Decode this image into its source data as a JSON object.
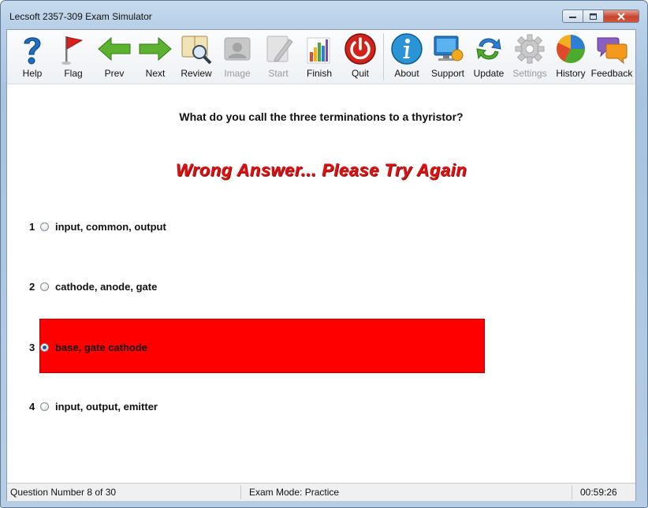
{
  "window": {
    "title": "Lecsoft 2357-309 Exam Simulator"
  },
  "toolbar": {
    "items": [
      {
        "label": "Help",
        "icon": "help-icon"
      },
      {
        "label": "Flag",
        "icon": "flag-icon"
      },
      {
        "label": "Prev",
        "icon": "prev-arrow-icon"
      },
      {
        "label": "Next",
        "icon": "next-arrow-icon"
      },
      {
        "label": "Review",
        "icon": "review-magnifier-icon"
      },
      {
        "label": "Image",
        "icon": "image-icon",
        "disabled": true
      },
      {
        "label": "Start",
        "icon": "start-pencil-icon",
        "disabled": true
      },
      {
        "label": "Finish",
        "icon": "finish-chart-icon"
      },
      {
        "label": "Quit",
        "icon": "power-icon"
      },
      {
        "label": "About",
        "icon": "info-icon"
      },
      {
        "label": "Support",
        "icon": "support-monitor-icon"
      },
      {
        "label": "Update",
        "icon": "update-arrows-icon"
      },
      {
        "label": "Settings",
        "icon": "gear-icon",
        "disabled": true
      },
      {
        "label": "History",
        "icon": "pie-chart-icon"
      },
      {
        "label": "Feedback",
        "icon": "speech-bubbles-icon"
      }
    ]
  },
  "question": {
    "text": "What do you call the three terminations to a thyristor?"
  },
  "feedback": {
    "text": "Wrong Answer... Please Try Again",
    "color": "#e01010"
  },
  "answers": [
    {
      "number": "1",
      "text": "input, common, output",
      "selected": false
    },
    {
      "number": "2",
      "text": "cathode, anode, gate",
      "selected": false
    },
    {
      "number": "3",
      "text": "base, gate cathode",
      "selected": true,
      "highlight_color": "#ff0000"
    },
    {
      "number": "4",
      "text": "input, output, emitter",
      "selected": false
    }
  ],
  "status": {
    "question_number": "Question Number 8 of 30",
    "exam_mode": "Exam Mode: Practice",
    "timer": "00:59:26"
  }
}
